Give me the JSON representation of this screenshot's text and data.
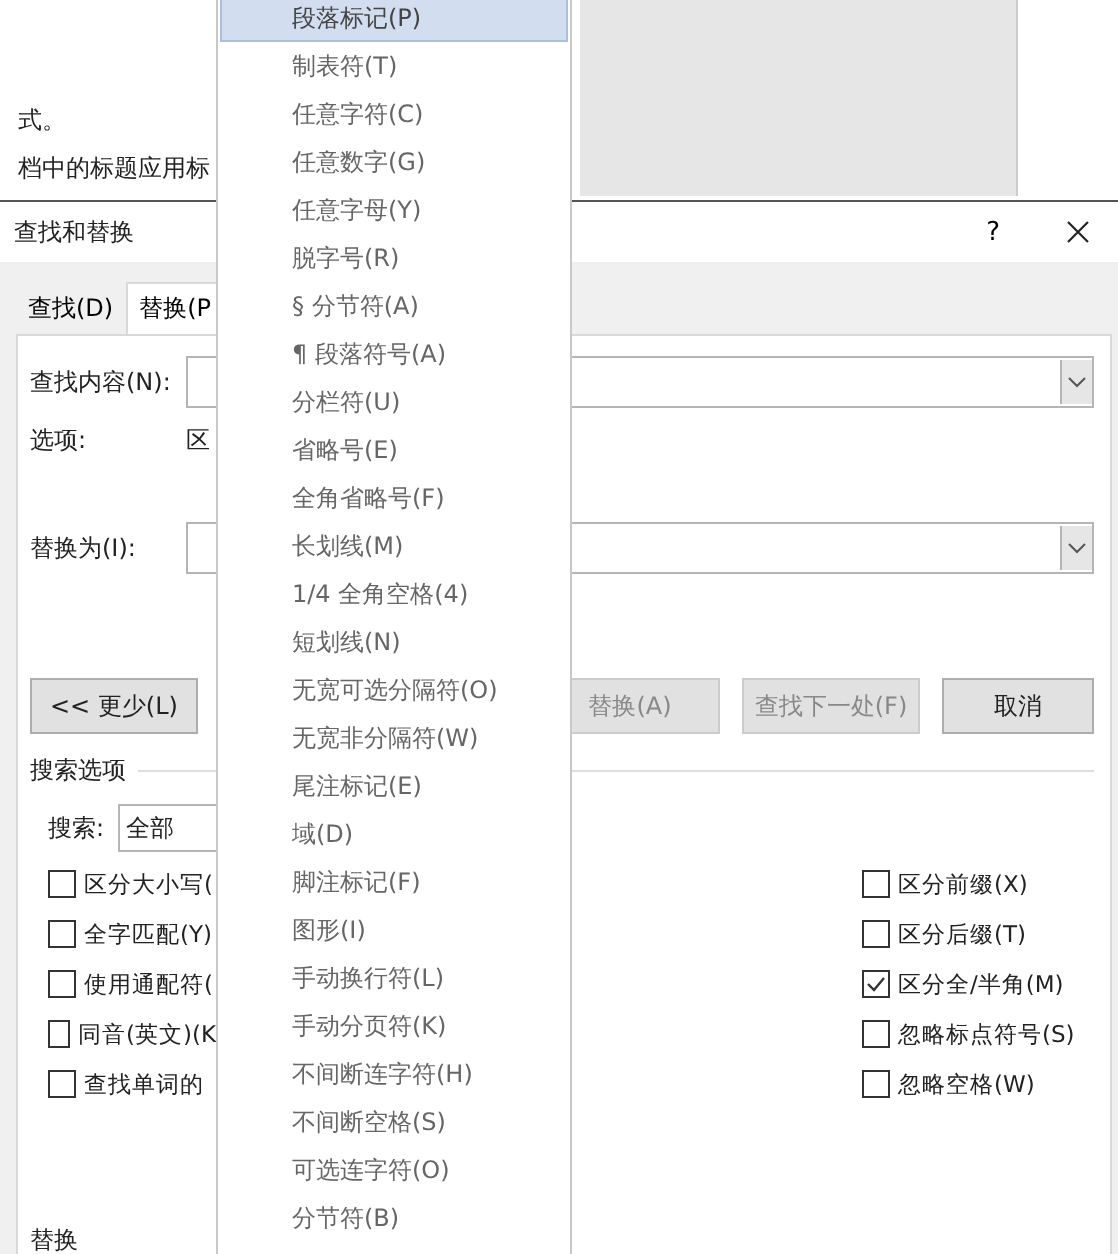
{
  "background_document": {
    "lines": [
      "式。",
      "档中的标题应用标"
    ]
  },
  "dialog": {
    "title": "查找和替换",
    "help": "?",
    "tabs": [
      {
        "label": "查找(D)",
        "selected": false
      },
      {
        "label": "替换(P",
        "selected": true
      }
    ],
    "find_what": {
      "label": "查找内容(N):"
    },
    "options": {
      "label": "选项:",
      "value": "区"
    },
    "replace_with": {
      "label": "替换为(I):"
    },
    "buttons": [
      {
        "label": "<< 更少(L)",
        "disabled": false
      },
      {
        "label": "替换(A)",
        "disabled": true
      },
      {
        "label": "查找下一处(F)",
        "disabled": true
      },
      {
        "label": "取消",
        "disabled": false
      }
    ],
    "search_options": {
      "title": "搜索选项",
      "search_label": "搜索:",
      "search_value": "全部",
      "left_checks": [
        {
          "label": "区分大小写(",
          "checked": false
        },
        {
          "label": "全字匹配(Y)",
          "checked": false
        },
        {
          "label": "使用通配符(",
          "checked": false
        },
        {
          "label": "同音(英文)(K",
          "checked": false
        },
        {
          "label": "查找单词的",
          "checked": false
        }
      ],
      "right_checks": [
        {
          "label": "区分前缀(X)",
          "checked": false
        },
        {
          "label": "区分后缀(T)",
          "checked": false
        },
        {
          "label": "区分全/半角(M)",
          "checked": true
        },
        {
          "label": "忽略标点符号(S)",
          "checked": false
        },
        {
          "label": "忽略空格(W)",
          "checked": false
        }
      ]
    },
    "replace_section": {
      "title": "替换"
    }
  },
  "special_menu": {
    "items": [
      {
        "label": "段落标记(P)",
        "selected": true
      },
      {
        "label": "制表符(T)",
        "selected": false
      },
      {
        "label": "任意字符(C)",
        "selected": false
      },
      {
        "label": "任意数字(G)",
        "selected": false
      },
      {
        "label": "任意字母(Y)",
        "selected": false
      },
      {
        "label": "脱字号(R)",
        "selected": false
      },
      {
        "label": "§ 分节符(A)",
        "selected": false
      },
      {
        "label": "¶ 段落符号(A)",
        "selected": false
      },
      {
        "label": "分栏符(U)",
        "selected": false
      },
      {
        "label": "省略号(E)",
        "selected": false
      },
      {
        "label": "全角省略号(F)",
        "selected": false
      },
      {
        "label": "长划线(M)",
        "selected": false
      },
      {
        "label": "1/4 全角空格(4)",
        "selected": false
      },
      {
        "label": "短划线(N)",
        "selected": false
      },
      {
        "label": "无宽可选分隔符(O)",
        "selected": false
      },
      {
        "label": "无宽非分隔符(W)",
        "selected": false
      },
      {
        "label": "尾注标记(E)",
        "selected": false
      },
      {
        "label": "域(D)",
        "selected": false
      },
      {
        "label": "脚注标记(F)",
        "selected": false
      },
      {
        "label": "图形(I)",
        "selected": false
      },
      {
        "label": "手动换行符(L)",
        "selected": false
      },
      {
        "label": "手动分页符(K)",
        "selected": false
      },
      {
        "label": "不间断连字符(H)",
        "selected": false
      },
      {
        "label": "不间断空格(S)",
        "selected": false
      },
      {
        "label": "可选连字符(O)",
        "selected": false
      },
      {
        "label": "分节符(B)",
        "selected": false
      }
    ]
  }
}
